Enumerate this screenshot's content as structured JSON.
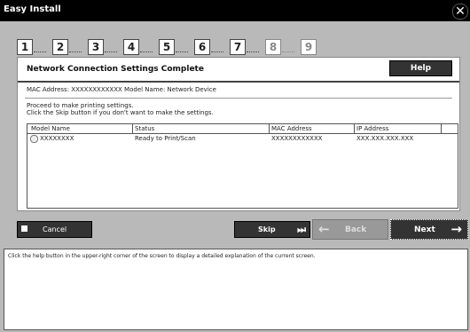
{
  "window": {
    "title": "Easy Install",
    "close_icon": "close-icon"
  },
  "steps": [
    {
      "num": "1",
      "enabled": true
    },
    {
      "num": "2",
      "enabled": true
    },
    {
      "num": "3",
      "enabled": true
    },
    {
      "num": "4",
      "enabled": true
    },
    {
      "num": "5",
      "enabled": true
    },
    {
      "num": "6",
      "enabled": true
    },
    {
      "num": "7",
      "enabled": true
    },
    {
      "num": "8",
      "enabled": false
    },
    {
      "num": "9",
      "enabled": false
    }
  ],
  "panel": {
    "title": "Network Connection Settings Complete",
    "help_label": "Help",
    "mac_line": "MAC Address: XXXXXXXXXXXX   Model Name: Network Device",
    "message_line1": "Proceed to make printing settings.",
    "message_line2": "Click the Skip button if you don't want to make the settings.",
    "table": {
      "headers": [
        "Model Name",
        "Status",
        "MAC Address",
        "IP Address"
      ],
      "rows": [
        {
          "model": "XXXXXXXX",
          "status": "Ready to Print/Scan",
          "mac": "XXXXXXXXXXXX",
          "ip": "XXX.XXX.XXX.XXX"
        }
      ]
    }
  },
  "buttons": {
    "cancel": "Cancel",
    "skip": "Skip",
    "back": "Back",
    "next": "Next"
  },
  "description": "Click the help button in the upper-right corner of the screen to display a detailed explanation of the current screen."
}
